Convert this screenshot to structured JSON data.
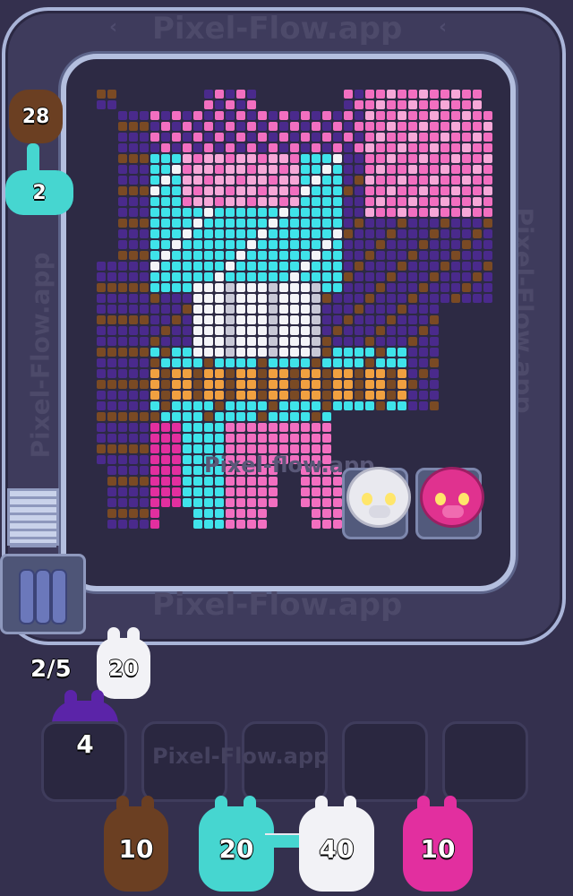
{
  "watermark": {
    "top": "Pixel-Flow.app",
    "center": "Pixel-flow.app",
    "bottom": "Pixel-Flow.app",
    "right": "Pixel-Flow.app",
    "left": "Pixel-Flow.app",
    "slots": "Pixel-Flow.app"
  },
  "conveyor_units": [
    {
      "name": "conveyor-unit-brown",
      "count": "28",
      "color": "#6b3f22"
    },
    {
      "name": "conveyor-unit-cyan",
      "count": "2",
      "color": "#46d6d0"
    }
  ],
  "capacity_counter": "2/5",
  "queue_front": {
    "count": "20",
    "color": "#f2f2f6"
  },
  "staged_unit": {
    "count": "4",
    "color": "#5b24a8"
  },
  "slots": [
    {
      "label": "empty"
    },
    {
      "label": "empty"
    },
    {
      "label": "empty"
    },
    {
      "label": "empty"
    },
    {
      "label": "empty"
    }
  ],
  "bottom_units": [
    {
      "count": "10",
      "color": "#6b3f22"
    },
    {
      "count": "20",
      "color": "#46d6d0"
    },
    {
      "count": "40",
      "color": "#f2f2f6"
    },
    {
      "count": "10",
      "color": "#e22f9f"
    }
  ],
  "pigs": [
    {
      "name": "white-pig",
      "color": "#e9e9ef"
    },
    {
      "name": "pink-pig",
      "color": "#e0328f"
    }
  ],
  "palette": {
    "pink": "#f26fc0",
    "light_pink": "#f7a8d8",
    "hot_pink": "#e22f9f",
    "cyan": "#3fe3ea",
    "white": "#f4f4f8",
    "grey": "#c8c8d6",
    "purple": "#4a2a8c",
    "brown": "#7a4a24",
    "orange": "#f0a040"
  }
}
